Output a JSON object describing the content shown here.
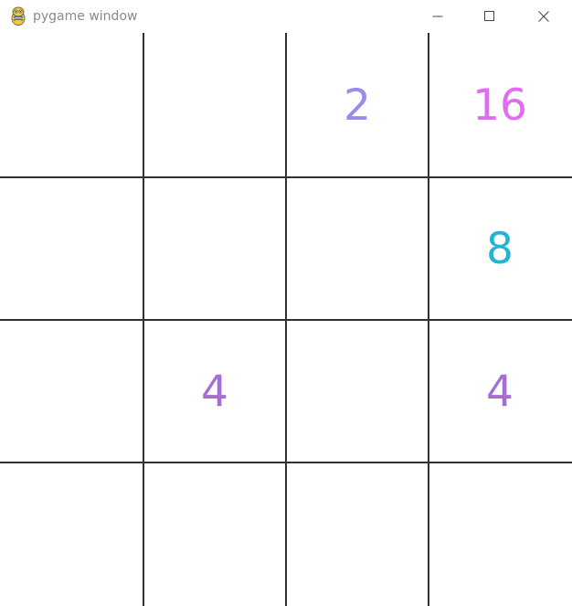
{
  "window": {
    "title": "pygame window",
    "icon": "pygame-snake-icon",
    "controls": [
      "minimize-icon",
      "maximize-icon",
      "close-icon"
    ]
  },
  "game": {
    "rows": 4,
    "cols": 4,
    "grid_color": "#303030",
    "tiles": [
      {
        "row": 0,
        "col": 0,
        "value": ""
      },
      {
        "row": 0,
        "col": 1,
        "value": ""
      },
      {
        "row": 0,
        "col": 2,
        "value": "2",
        "color": "#9b8ae6"
      },
      {
        "row": 0,
        "col": 3,
        "value": "16",
        "color": "#e06cf0"
      },
      {
        "row": 1,
        "col": 0,
        "value": ""
      },
      {
        "row": 1,
        "col": 1,
        "value": ""
      },
      {
        "row": 1,
        "col": 2,
        "value": ""
      },
      {
        "row": 1,
        "col": 3,
        "value": "8",
        "color": "#22b4d4"
      },
      {
        "row": 2,
        "col": 0,
        "value": ""
      },
      {
        "row": 2,
        "col": 1,
        "value": "4",
        "color": "#a46fd0"
      },
      {
        "row": 2,
        "col": 2,
        "value": ""
      },
      {
        "row": 2,
        "col": 3,
        "value": "4",
        "color": "#a46fd0"
      },
      {
        "row": 3,
        "col": 0,
        "value": ""
      },
      {
        "row": 3,
        "col": 1,
        "value": ""
      },
      {
        "row": 3,
        "col": 2,
        "value": ""
      },
      {
        "row": 3,
        "col": 3,
        "value": ""
      }
    ]
  }
}
